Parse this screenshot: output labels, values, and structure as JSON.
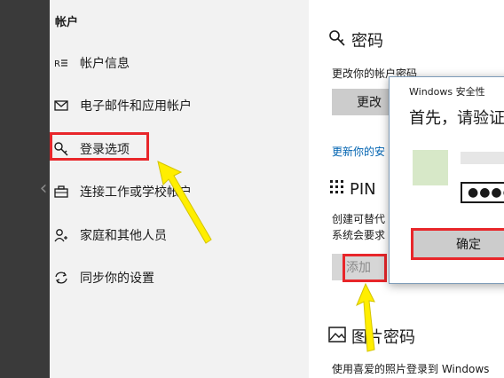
{
  "sidebar": {
    "title": "帐户",
    "items": [
      {
        "label": "帐户信息",
        "icon": "person-list-icon"
      },
      {
        "label": "电子邮件和应用帐户",
        "icon": "mail-icon"
      },
      {
        "label": "登录选项",
        "icon": "key-icon"
      },
      {
        "label": "连接工作或学校帐户",
        "icon": "briefcase-icon"
      },
      {
        "label": "家庭和其他人员",
        "icon": "person-add-icon"
      },
      {
        "label": "同步你的设置",
        "icon": "sync-icon"
      }
    ]
  },
  "main": {
    "password_heading": "密码",
    "password_desc": "更改你的帐户密码",
    "change_button": "更改",
    "update_link": "更新你的安",
    "pin_heading": "PIN",
    "pin_desc_line1": "创建可替代",
    "pin_desc_line2": "系统会要求",
    "add_button": "添加",
    "picture_heading": "图片密码",
    "picture_desc": "使用喜爱的照片登录到 Windows"
  },
  "dialog": {
    "title": "Windows 安全性",
    "heading": "首先，请验证",
    "pin_value": "●●●●",
    "ok_button": "确定"
  },
  "colors": {
    "highlight": "#e8262a",
    "arrow": "#ffee00",
    "link": "#0063b1"
  }
}
